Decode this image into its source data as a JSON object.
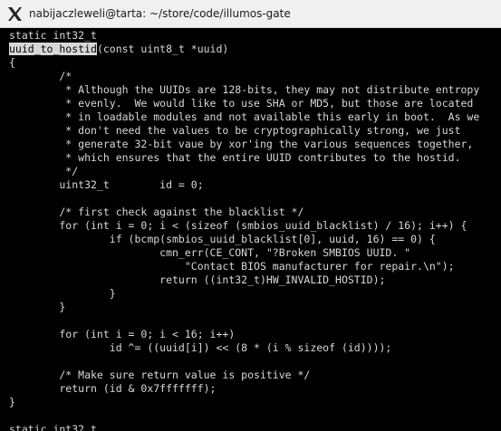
{
  "window": {
    "title": "nabijaczleweli@tarta: ~/store/code/illumos-gate",
    "app_icon": "x-window-system-icon"
  },
  "terminal": {
    "lines": [
      "static int32_t",
      "uuid_to_hostid(const uint8_t *uuid)",
      "{",
      "        /*",
      "         * Although the UUIDs are 128-bits, they may not distribute entropy",
      "         * evenly.  We would like to use SHA or MD5, but those are located",
      "         * in loadable modules and not available this early in boot.  As we",
      "         * don't need the values to be cryptographically strong, we just",
      "         * generate 32-bit vaue by xor'ing the various sequences together,",
      "         * which ensures that the entire UUID contributes to the hostid.",
      "         */",
      "        uint32_t        id = 0;",
      "",
      "        /* first check against the blacklist */",
      "        for (int i = 0; i < (sizeof (smbios_uuid_blacklist) / 16); i++) {",
      "                if (bcmp(smbios_uuid_blacklist[0], uuid, 16) == 0) {",
      "                        cmn_err(CE_CONT, \"?Broken SMBIOS UUID. \"",
      "                            \"Contact BIOS manufacturer for repair.\\n\");",
      "                        return ((int32_t)HW_INVALID_HOSTID);",
      "                }",
      "        }",
      "",
      "        for (int i = 0; i < 16; i++)",
      "                id ^= ((uuid[i]) << (8 * (i % sizeof (id))));",
      "",
      "        /* Make sure return value is positive */",
      "        return (id & 0x7fffffff);",
      "}",
      "",
      "static int32_t"
    ],
    "highlighted_text": "uuid_to_hostid",
    "highlighted_line": 1,
    "colors": {
      "background": "#000000",
      "foreground": "#d8d8d8",
      "highlight_background": "#d8d8d8",
      "highlight_foreground": "#000000",
      "titlebar": "#f0f0f0"
    }
  }
}
